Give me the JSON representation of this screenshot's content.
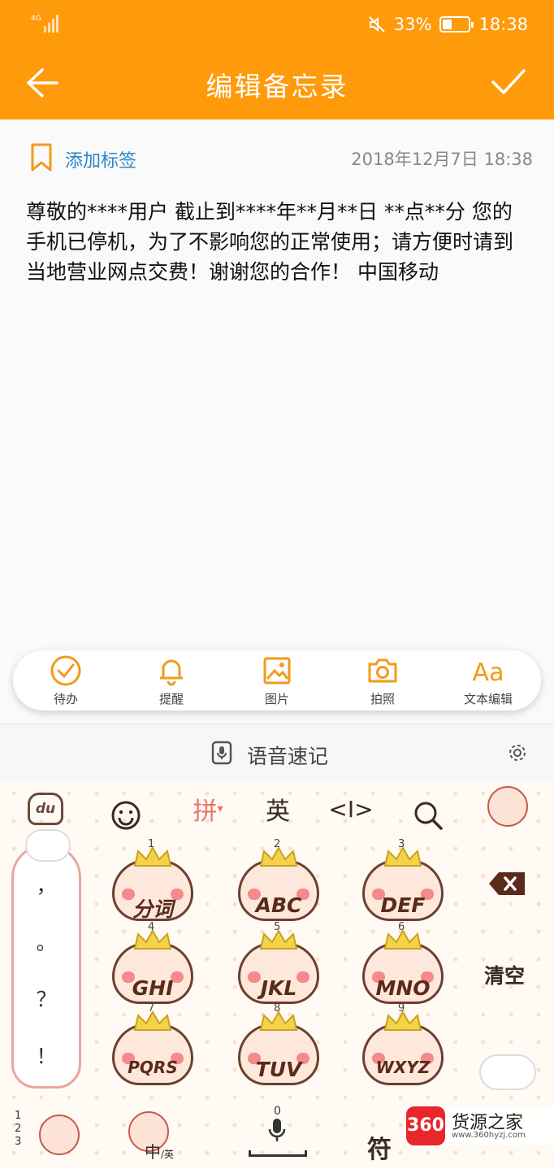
{
  "status_bar": {
    "network": "4G",
    "battery": "33%",
    "battery_level": 0.33,
    "time": "18:38"
  },
  "header": {
    "title": "编辑备忘录"
  },
  "note": {
    "tag_label": "添加标签",
    "date": "2018年12月7日 18:38",
    "body": "尊敬的****用户 截止到****年**月**日 **点**分 您的手机已停机，为了不影响您的正常使用；请方便时请到当地营业网点交费！谢谢您的合作！ 中国移动"
  },
  "toolbar": {
    "items": [
      {
        "label": "待办",
        "icon": "todo-check-icon"
      },
      {
        "label": "提醒",
        "icon": "bell-icon"
      },
      {
        "label": "图片",
        "icon": "image-icon"
      },
      {
        "label": "拍照",
        "icon": "camera-icon"
      },
      {
        "label": "文本编辑",
        "icon": "text-format-icon",
        "glyph": "Aa"
      }
    ]
  },
  "keyboard": {
    "voice_label": "语音速记",
    "top": {
      "du": "du",
      "pinyin": "拼",
      "english": "英",
      "cursor": "<I>"
    },
    "punct": [
      "，",
      "。",
      "？",
      "！"
    ],
    "keys": [
      {
        "num": "1",
        "label": "分词"
      },
      {
        "num": "2",
        "label": "ABC"
      },
      {
        "num": "3",
        "label": "DEF"
      },
      {
        "num": "4",
        "label": "GHI"
      },
      {
        "num": "5",
        "label": "JKL"
      },
      {
        "num": "6",
        "label": "MNO"
      },
      {
        "num": "7",
        "label": "PQRS"
      },
      {
        "num": "8",
        "label": "TUV"
      },
      {
        "num": "9",
        "label": "WXYZ"
      }
    ],
    "clear_label": "清空",
    "bottom": {
      "nums": "1\n2\n3",
      "zh_en": "中",
      "zh_en_sub": "/英",
      "zero": "0",
      "symbols": "符"
    }
  },
  "watermark": {
    "badge": "360",
    "name": "货源之家",
    "url": "www.360hyzj.com"
  },
  "colors": {
    "accent": "#ff9a0b",
    "tag_blue": "#2a86c9",
    "toolbar_icon": "#f29a1b"
  }
}
